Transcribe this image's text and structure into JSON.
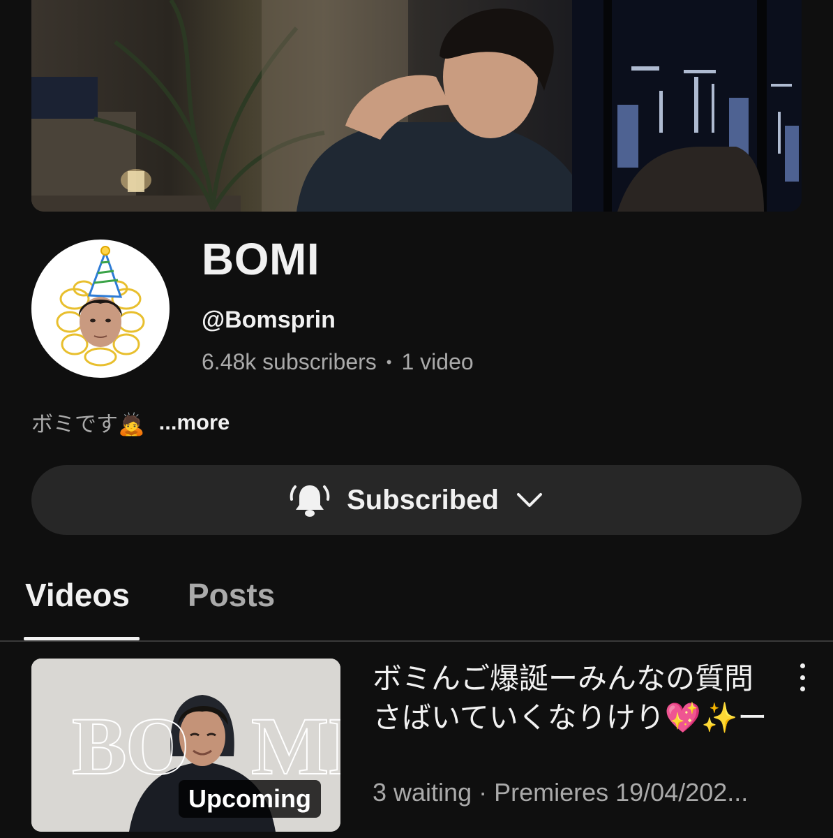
{
  "channel": {
    "name": "BOMI",
    "handle": "@Bomsprin",
    "subscribers": "6.48k subscribers",
    "separator": "•",
    "video_count": "1 video",
    "description": "ボミです🙇",
    "more_label": "...more"
  },
  "subscribe": {
    "label": "Subscribed",
    "icon": "bell-icon",
    "chevron": "chevron-down-icon"
  },
  "tabs": [
    {
      "label": "Videos",
      "active": true
    },
    {
      "label": "Posts",
      "active": false
    }
  ],
  "video": {
    "title": "ボミんご爆誕ーみんなの質問さばいていくなりけり💖✨ー",
    "meta": "3 waiting · Premieres 19/04/202...",
    "badge": "Upcoming",
    "thumb_text_left": "BO",
    "thumb_text_right": "MI",
    "menu_icon": "more-vert-icon"
  },
  "colors": {
    "background": "#0f0f0f",
    "button": "#272727",
    "text": "#f1f1f1",
    "secondary_text": "#aaaaaa"
  }
}
